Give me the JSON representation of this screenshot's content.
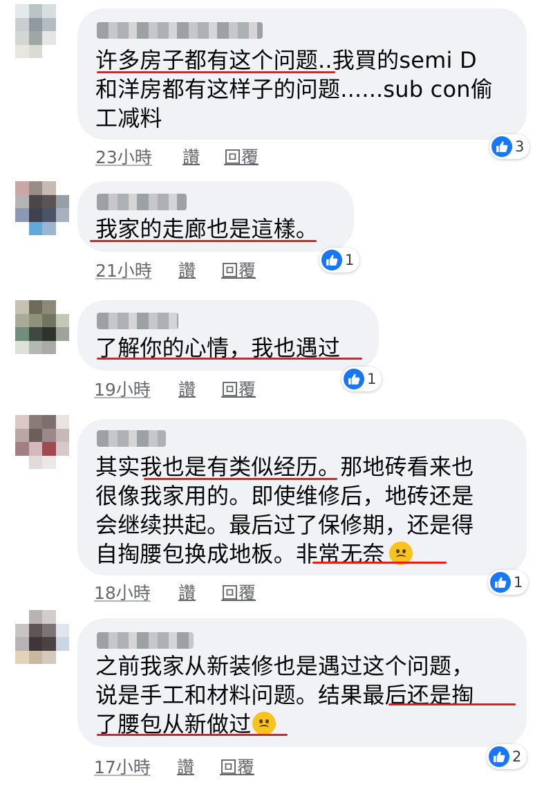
{
  "comments": [
    {
      "text": "许多房子都有这个问题..我買的semi  D\n和洋房都有这样子的问题......sub con偷\n工减料",
      "time": "23小時",
      "like": "讚",
      "reply": "回覆",
      "reactions": "3"
    },
    {
      "text": "我家的走廊也是這樣。",
      "time": "21小時",
      "like": "讚",
      "reply": "回覆",
      "reactions": "1"
    },
    {
      "text": "了解你的心情，我也遇过",
      "time": "19小時",
      "like": "讚",
      "reply": "回覆",
      "reactions": "1"
    },
    {
      "text": "其实我也是有类似经历。那地砖看来也\n很像我家用的。即使维修后，地砖还是\n会继续拱起。最后过了保修期，还是得\n自掏腰包换成地板。非常无奈",
      "time": "18小時",
      "like": "讚",
      "reply": "回覆",
      "reactions": "1",
      "emoji": "frowning-face"
    },
    {
      "text": "之前我家从新装修也是遇过这个问题，\n说是手工和材料问题。结果最后还是掏\n了腰包从新做过",
      "time": "17小時",
      "like": "讚",
      "reply": "回覆",
      "reactions": "2",
      "emoji": "frowning-face"
    }
  ],
  "colors": {
    "bubble": "#f0f2f5",
    "highlight_underline": "#e0201b",
    "like_blue": "#1877f2"
  }
}
